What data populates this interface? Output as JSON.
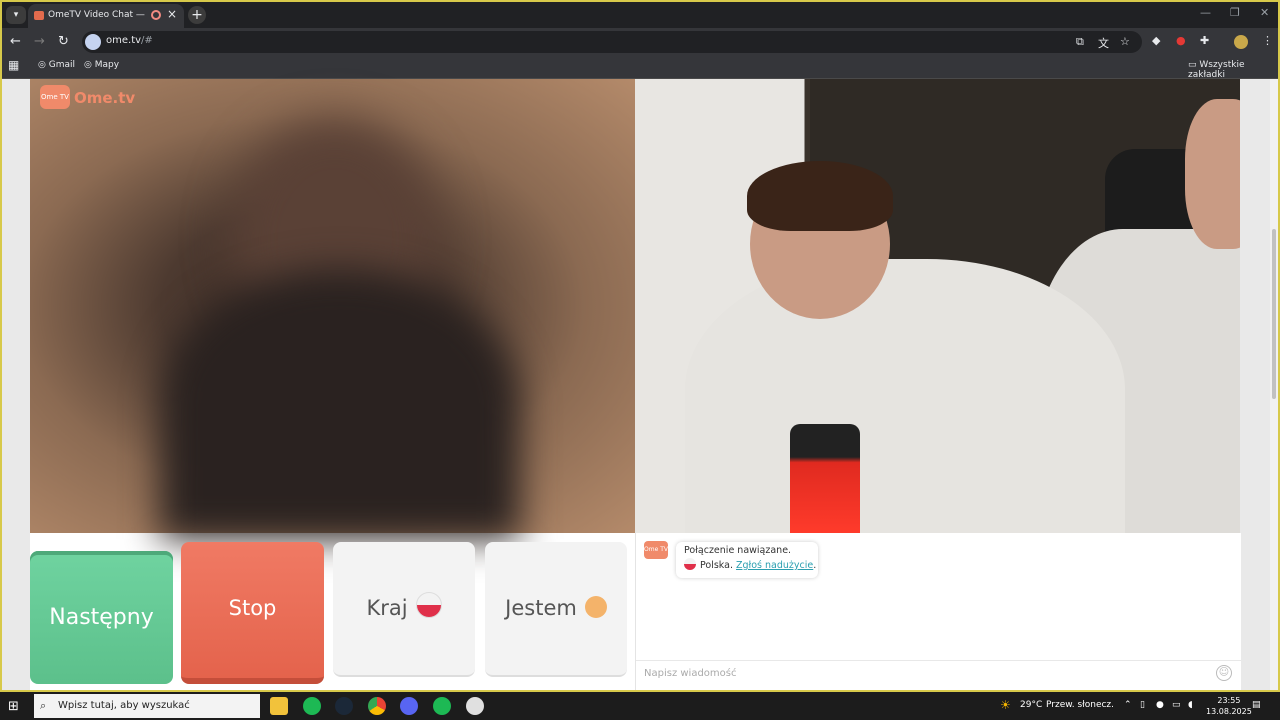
{
  "browser": {
    "tab_menu_icon": "chevron-down",
    "tab_title": "OmeTV Video Chat — Ome",
    "url_host": "ome.tv",
    "url_rest": "/#",
    "bookmarks": [
      {
        "label": "Gmail"
      },
      {
        "label": "Mapy"
      }
    ],
    "all_bookmarks": "Wszystkie zakładki"
  },
  "site": {
    "logo_icon_text": "Ome TV",
    "logo_text": "Ome.tv"
  },
  "controls": {
    "next_label": "Następny",
    "stop_label": "Stop",
    "country_label": "Kraj",
    "gender_label": "Jestem"
  },
  "chat": {
    "logo_icon_text": "Ome TV",
    "connected": "Połączenie nawiązane.",
    "country": "Polska.",
    "report_link": "Zgłoś nadużycie",
    "report_suffix": ".",
    "input_placeholder": "Napisz wiadomość"
  },
  "taskbar": {
    "search_placeholder": "Wpisz tutaj, aby wyszukać",
    "temperature": "29°C",
    "weather": "Przew. słonecz.",
    "time": "23:55",
    "date": "13.08.2025"
  },
  "colors": {
    "next": "#5cc08b",
    "stop": "#e4634c",
    "brand": "#f08a6a",
    "link": "#2a9fb0"
  }
}
